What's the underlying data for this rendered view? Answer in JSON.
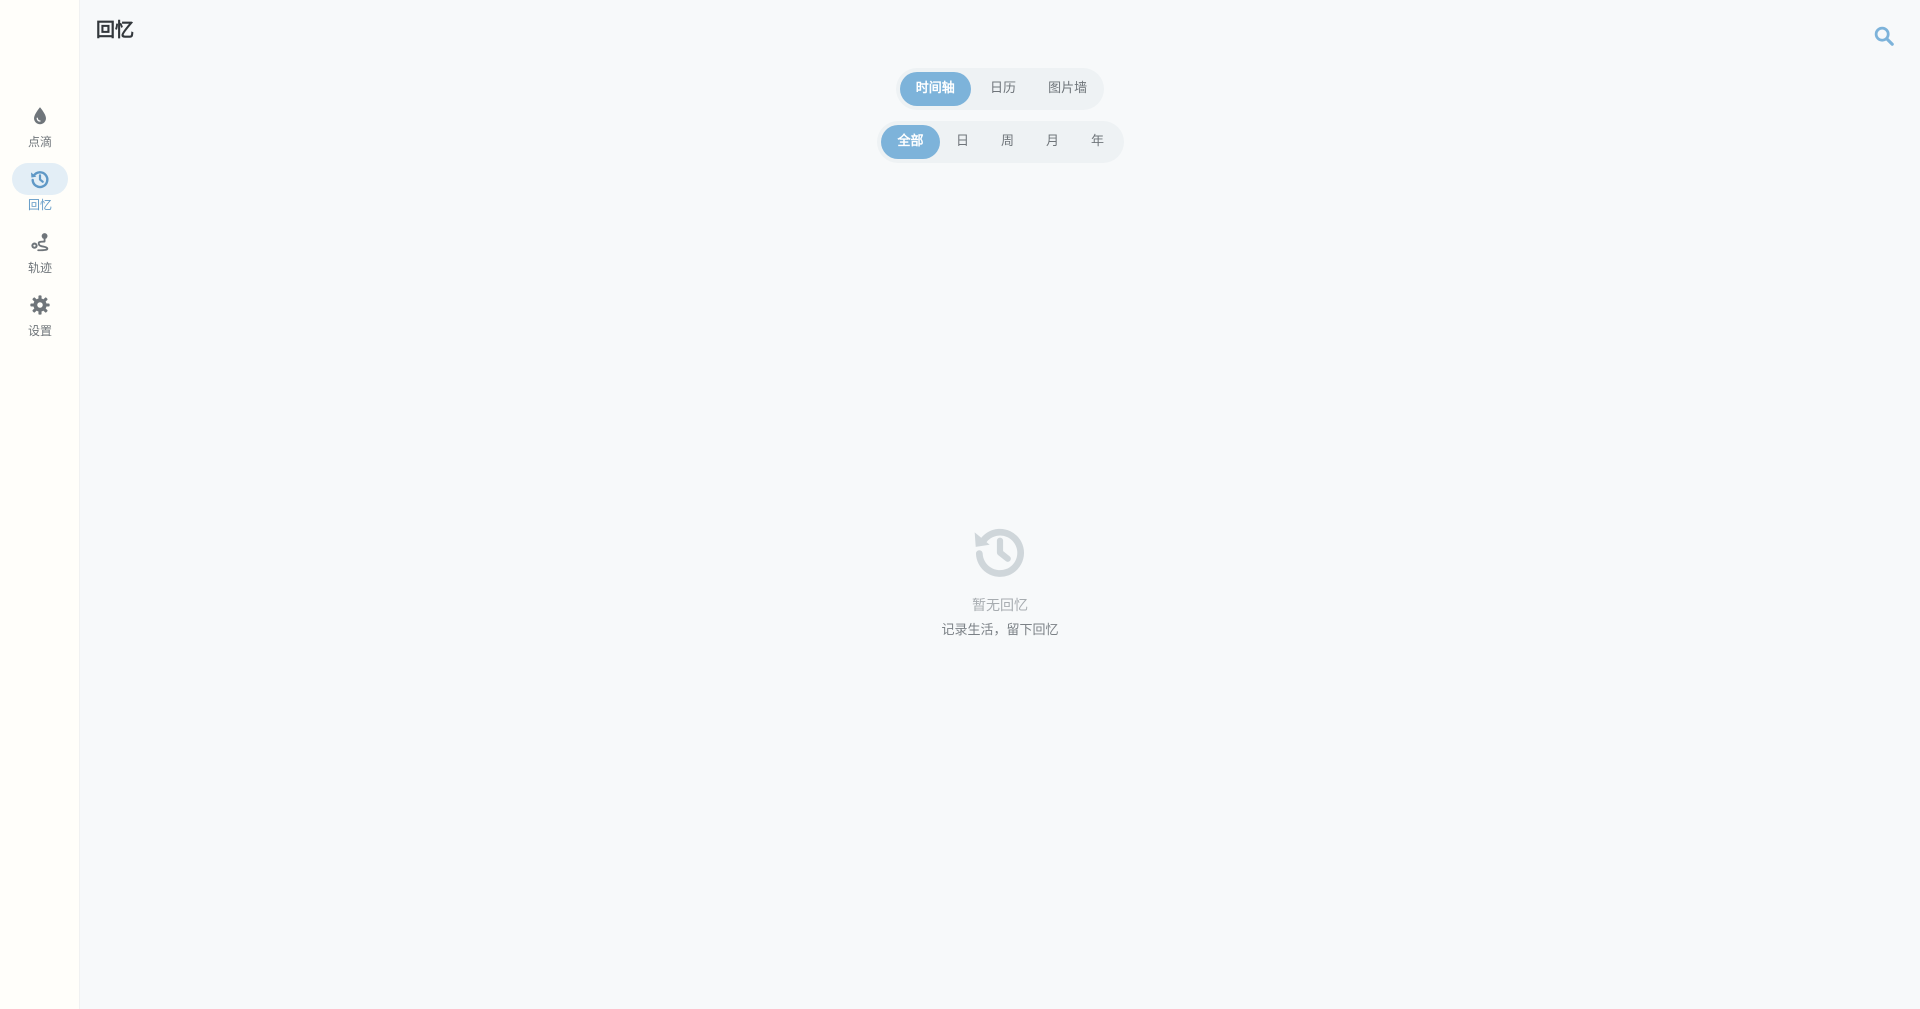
{
  "header": {
    "title": "回忆",
    "search_icon": "search-icon"
  },
  "sidebar": {
    "items": [
      {
        "id": "diandi",
        "label": "点滴",
        "icon": "drop-icon",
        "active": false
      },
      {
        "id": "huiyi",
        "label": "回忆",
        "icon": "history-icon",
        "active": true
      },
      {
        "id": "guiji",
        "label": "轨迹",
        "icon": "route-icon",
        "active": false
      },
      {
        "id": "shezhi",
        "label": "设置",
        "icon": "gear-icon",
        "active": false
      }
    ]
  },
  "view_tabs": {
    "items": [
      "时间轴",
      "日历",
      "图片墙"
    ],
    "selected": "时间轴"
  },
  "range_tabs": {
    "items": [
      "全部",
      "日",
      "周",
      "月",
      "年"
    ],
    "selected": "全部"
  },
  "empty_state": {
    "icon": "history-icon",
    "title": "暂无回忆",
    "subtitle": "记录生活，留下回忆"
  },
  "colors": {
    "accent": "#7db3da",
    "accent_text": "#5f98c6",
    "active_nav_bg": "#e3eef6",
    "icon_gray": "#6f757a",
    "empty_icon": "#cfd6da",
    "background": "#f7f9fa",
    "sidebar_bg": "#fffefa"
  }
}
